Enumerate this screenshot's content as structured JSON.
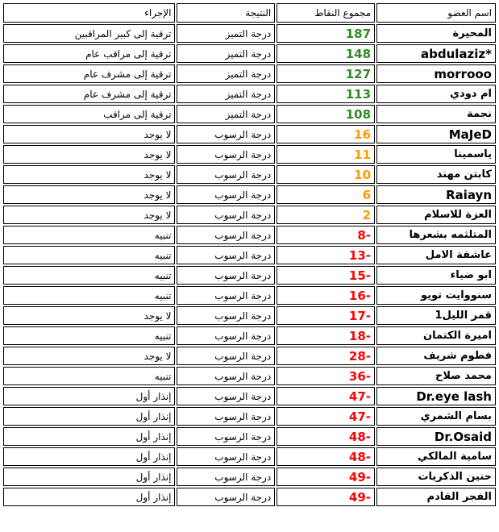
{
  "table": {
    "headers": {
      "name": "اسم العضو",
      "points": "مجموع النقاط",
      "result": "النتيجة",
      "action": "الإجراء"
    },
    "status_colors": {
      "green": "#2e8b22",
      "orange": "#ff9900",
      "red": "#ff0000"
    },
    "rows": [
      {
        "name": "المحيرة",
        "points": "187",
        "result": "درجة التميز",
        "action": "ترقية إلى كبير المراقبين",
        "status": "green"
      },
      {
        "name": "*abdulaziz",
        "points": "148",
        "result": "درجة التميز",
        "action": "ترقية إلى مراقب عام",
        "status": "green"
      },
      {
        "name": "morrooo",
        "points": "127",
        "result": "درجة التميز",
        "action": "ترقية إلى مشرف عام",
        "status": "green"
      },
      {
        "name": "ام دودي",
        "points": "113",
        "result": "درجة التميز",
        "action": "ترقية إلى مشرف عام",
        "status": "green"
      },
      {
        "name": "نجمة",
        "points": "108",
        "result": "درجة التميز",
        "action": "ترقية إلى مراقب",
        "status": "green"
      },
      {
        "name": "MaJeD",
        "points": "16",
        "result": "درجة الرسوب",
        "action": "لا يوجد",
        "status": "orange"
      },
      {
        "name": "ياسمينا",
        "points": "11",
        "result": "درجة الرسوب",
        "action": "لا يوجد",
        "status": "orange"
      },
      {
        "name": "كابتن مهند",
        "points": "10",
        "result": "درجة الرسوب",
        "action": "لا يوجد",
        "status": "orange"
      },
      {
        "name": "Raiayn",
        "points": "6",
        "result": "درجة الرسوب",
        "action": "لا يوجد",
        "status": "orange"
      },
      {
        "name": "العزة للاسلام",
        "points": "2",
        "result": "درجة الرسوب",
        "action": "لا يوجد",
        "status": "orange"
      },
      {
        "name": "المتلثمه بشعرها",
        "points": "-8",
        "result": "درجة الرسوب",
        "action": "تنبيه",
        "status": "red"
      },
      {
        "name": "عاشقة الامل",
        "points": "-13",
        "result": "درجة الرسوب",
        "action": "تنبيه",
        "status": "red"
      },
      {
        "name": "ابو ضياء",
        "points": "-15",
        "result": "درجة الرسوب",
        "action": "تنبيه",
        "status": "red"
      },
      {
        "name": "سنووايت تويو",
        "points": "-16",
        "result": "درجة الرسوب",
        "action": "تنبيه",
        "status": "red"
      },
      {
        "name": "قمر الليل1",
        "points": "-17",
        "result": "درجة الرسوب",
        "action": "لا يوجد",
        "status": "red"
      },
      {
        "name": "اميرة الكتمان",
        "points": "-18",
        "result": "درجة الرسوب",
        "action": "تنبيه",
        "status": "red"
      },
      {
        "name": "فطوم شريف",
        "points": "-28",
        "result": "درجة الرسوب",
        "action": "لا يوجد",
        "status": "red"
      },
      {
        "name": "محمد صلاح",
        "points": "-36",
        "result": "درجة الرسوب",
        "action": "تنبيه",
        "status": "red"
      },
      {
        "name": "Dr.eye lash",
        "points": "-47",
        "result": "درجة الرسوب",
        "action": "إنذار أول",
        "status": "red"
      },
      {
        "name": "بسام الشمري",
        "points": "-47",
        "result": "درجة الرسوب",
        "action": "إنذار أول",
        "status": "red"
      },
      {
        "name": "Dr.Osaid",
        "points": "-48",
        "result": "درجة الرسوب",
        "action": "إنذار أول",
        "status": "red"
      },
      {
        "name": "سامية المالكي",
        "points": "-48",
        "result": "درجة الرسوب",
        "action": "إنذار أول",
        "status": "red"
      },
      {
        "name": "حنين الذكريات",
        "points": "-49",
        "result": "درجة الرسوب",
        "action": "إنذار أول",
        "status": "red"
      },
      {
        "name": "الفجر القادم",
        "points": "-49",
        "result": "درجة الرسوب",
        "action": "إنذار أول",
        "status": "red"
      }
    ]
  }
}
